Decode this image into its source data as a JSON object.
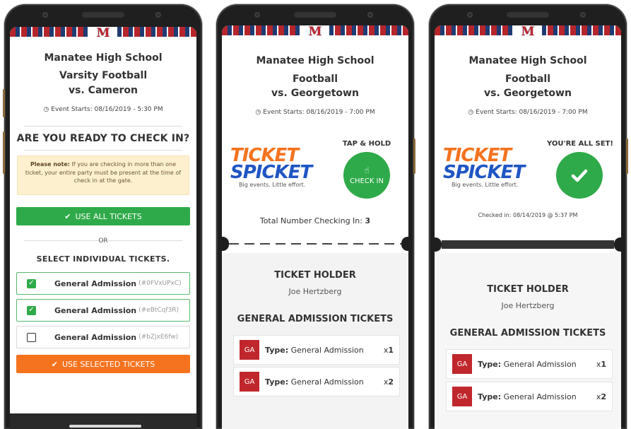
{
  "school_logo_letter": "M",
  "screens": [
    {
      "school": "Manatee High School",
      "sport_line1": "Varsity Football",
      "sport_line2": "vs. Cameron",
      "event_starts": "Event Starts: 08/16/2019 - 5:30 PM",
      "ready_title": "ARE YOU READY TO CHECK IN?",
      "note_bold": "Please note:",
      "note_text": " If you are checking in more than one ticket, your entire party must be present at the time of check in at the gate.",
      "use_all_label": "USE ALL TICKETS",
      "or_label": "OR",
      "select_title": "SELECT INDIVIDUAL TICKETS.",
      "tickets": [
        {
          "name": "General Admission",
          "code": "(#0FVxUPxC)",
          "checked": true
        },
        {
          "name": "General Admission",
          "code": "(#eBtCqf3R)",
          "checked": true
        },
        {
          "name": "General Admission",
          "code": "(#bZjxE6fw)",
          "checked": false
        }
      ],
      "use_selected_label": "USE SELECTED TICKETS"
    },
    {
      "school": "Manatee High School",
      "sport_line1": "Football",
      "sport_line2": "vs. Georgetown",
      "event_starts": "Event Starts: 08/16/2019 - 7:00 PM",
      "brand_line1": "TICKET",
      "brand_line2": "SPICKET",
      "brand_tagline": "Big events. Little effort.",
      "tap_title": "TAP & HOLD",
      "check_in_label": "CHECK IN",
      "total_label": "Total Number Checking In:",
      "total_value": "3",
      "holder_title": "TICKET HOLDER",
      "holder_name": "Joe Hertzberg",
      "ga_title": "GENERAL ADMISSION TICKETS",
      "rows": [
        {
          "badge": "GA",
          "type_label": "Type:",
          "type_value": "General Admission",
          "qty_prefix": "x",
          "qty": "1"
        },
        {
          "badge": "GA",
          "type_label": "Type:",
          "type_value": "General Admission",
          "qty_prefix": "x",
          "qty": "2"
        }
      ]
    },
    {
      "school": "Manatee High School",
      "sport_line1": "Football",
      "sport_line2": "vs. Georgetown",
      "event_starts": "Event Starts: 08/16/2019 - 7:00 PM",
      "brand_line1": "TICKET",
      "brand_line2": "SPICKET",
      "brand_tagline": "Big events. Little effort.",
      "all_set_title": "YOU'RE ALL SET!",
      "checked_in_text": "Checked in: 08/14/2019 @ 5:37 PM",
      "holder_title": "TICKET HOLDER",
      "holder_name": "Joe Hertzberg",
      "ga_title": "GENERAL ADMISSION TICKETS",
      "rows": [
        {
          "badge": "GA",
          "type_label": "Type:",
          "type_value": "General Admission",
          "qty_prefix": "x",
          "qty": "1"
        },
        {
          "badge": "GA",
          "type_label": "Type:",
          "type_value": "General Admission",
          "qty_prefix": "x",
          "qty": "2"
        }
      ]
    }
  ],
  "colors": {
    "green": "#2faa4a",
    "orange": "#f5731f",
    "brand_blue": "#1f56c4",
    "school_red": "#c0272d",
    "note_bg": "#fdf0cf"
  }
}
